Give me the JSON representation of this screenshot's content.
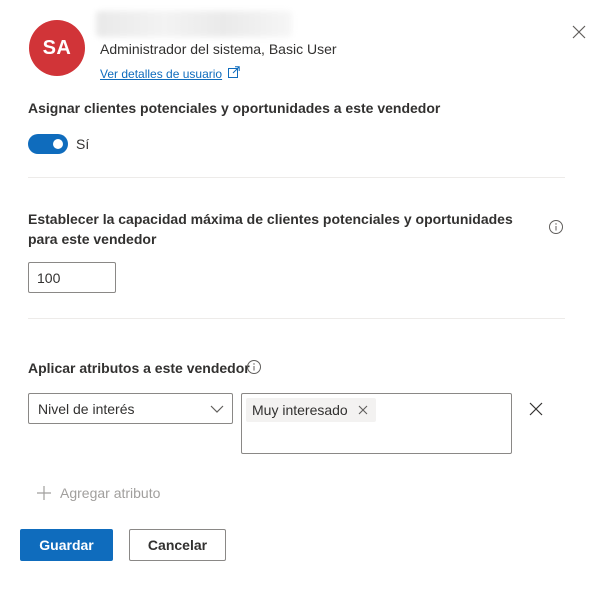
{
  "user": {
    "initials": "SA",
    "role": "Administrador del sistema, Basic User",
    "details_link": "Ver detalles de usuario"
  },
  "assign": {
    "label": "Asignar clientes potenciales y oportunidades a este vendedor",
    "toggle_text": "Sí",
    "enabled": true
  },
  "capacity": {
    "label": "Establecer la capacidad máxima de clientes potenciales y oportunidades para este vendedor",
    "value": "100"
  },
  "attributes": {
    "label": "Aplicar atributos a este vendedor",
    "rows": [
      {
        "attribute": "Nivel de interés",
        "values": [
          "Muy interesado"
        ]
      }
    ],
    "add_label": "Agregar atributo"
  },
  "actions": {
    "save_label": "Guardar",
    "cancel_label": "Cancelar"
  },
  "colors": {
    "avatar": "#d13438",
    "accent": "#0f6cbd"
  },
  "icons": [
    "close-icon",
    "external-link-icon",
    "info-icon",
    "chevron-down-icon",
    "dismiss-icon",
    "plus-icon"
  ]
}
